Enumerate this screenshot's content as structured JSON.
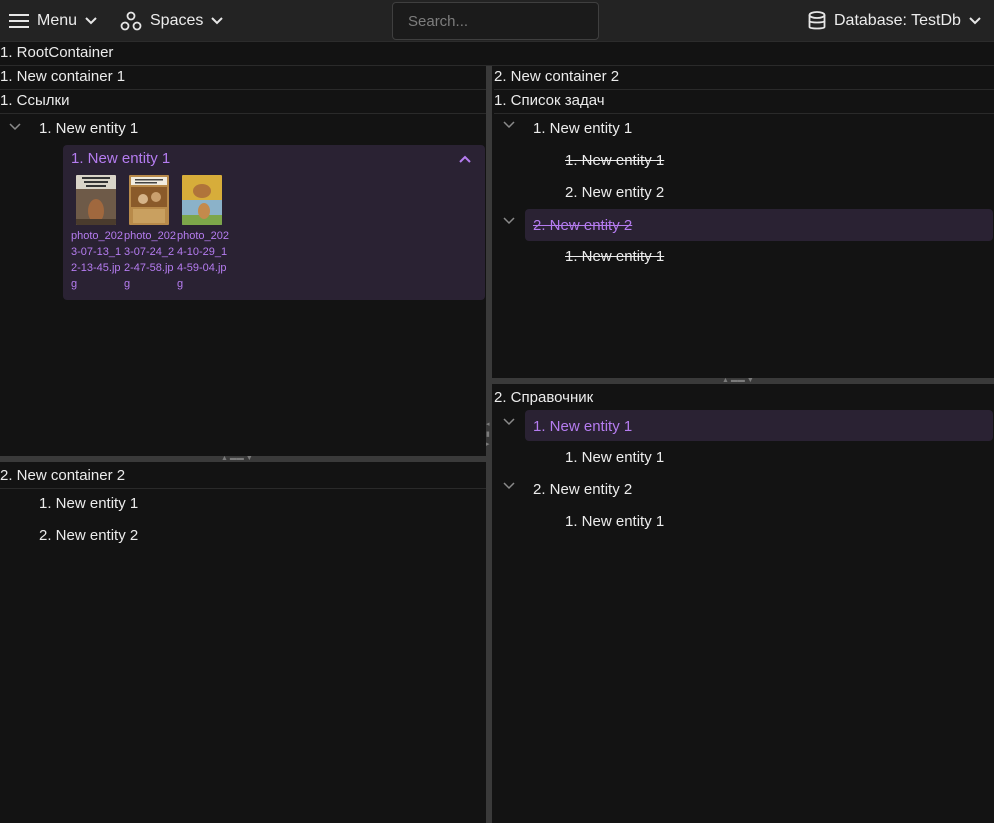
{
  "topbar": {
    "menu_label": "Menu",
    "spaces_label": "Spaces",
    "search_placeholder": "Search...",
    "database_label": "Database: TestDb"
  },
  "root": {
    "title": "1. RootContainer"
  },
  "left_top": {
    "title": "1. New container 1",
    "section": "1. Ссылки",
    "entity": "1. New entity 1",
    "card": {
      "title": "1. New entity 1",
      "files": [
        {
          "name": "photo_2023-07-13_12-13-45.jpg",
          "icon": "image-thumbnail"
        },
        {
          "name": "photo_2023-07-24_22-47-58.jpg",
          "icon": "image-thumbnail"
        },
        {
          "name": "photo_2024-10-29_14-59-04.jpg",
          "icon": "image-thumbnail"
        }
      ]
    }
  },
  "left_bottom": {
    "title": "2. New container 2",
    "items": [
      "1. New entity 1",
      "2. New entity 2"
    ]
  },
  "right_top": {
    "title": "2. New container 2",
    "section": "1. Список задач",
    "entity1": "1. New entity 1",
    "entity1_children": [
      "1. New entity 1",
      "2. New entity 2"
    ],
    "entity2": "2. New entity 2",
    "entity2_children": [
      "1. New entity 1"
    ]
  },
  "right_bottom": {
    "section": "2. Справочник",
    "entity1": "1. New entity 1",
    "entity1_children": [
      "1. New entity 1"
    ],
    "entity2": "2. New entity 2",
    "entity2_children": [
      "1. New entity 1"
    ]
  },
  "colors": {
    "accent": "#b57cf0",
    "selection": "#2a2233",
    "background": "#131313",
    "topbar": "#232323"
  }
}
